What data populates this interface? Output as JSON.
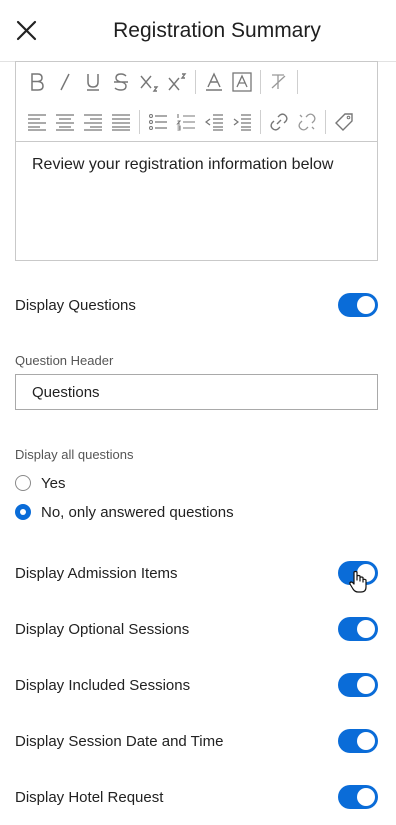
{
  "header": {
    "title": "Registration Summary",
    "close_icon": "close-icon"
  },
  "editor": {
    "toolbar": {
      "row1": [
        "bold-icon",
        "italic-icon",
        "underline-icon",
        "strikethrough-icon",
        "subscript-icon",
        "superscript-icon",
        "text-color-icon",
        "background-color-icon",
        "clear-format-icon"
      ],
      "row2": [
        "align-left-icon",
        "align-center-icon",
        "align-right-icon",
        "align-justify-icon",
        "bulleted-list-icon",
        "numbered-list-icon",
        "outdent-icon",
        "indent-icon",
        "link-icon",
        "unlink-icon",
        "tag-icon"
      ]
    },
    "content": "Review your registration information below"
  },
  "display_questions": {
    "label": "Display Questions",
    "on": true
  },
  "question_header": {
    "label": "Question Header",
    "value": "Questions"
  },
  "display_all_questions": {
    "label": "Display all questions",
    "options": [
      {
        "label": "Yes",
        "checked": false
      },
      {
        "label": "No, only answered questions",
        "checked": true
      }
    ]
  },
  "toggles": [
    {
      "label": "Display Admission Items",
      "on": true
    },
    {
      "label": "Display Optional Sessions",
      "on": true
    },
    {
      "label": "Display Included Sessions",
      "on": true
    },
    {
      "label": "Display Session Date and Time",
      "on": true
    },
    {
      "label": "Display Hotel Request",
      "on": true
    }
  ],
  "colors": {
    "accent": "#0a6cd8",
    "border": "#c9c9c9",
    "text": "#222222"
  }
}
